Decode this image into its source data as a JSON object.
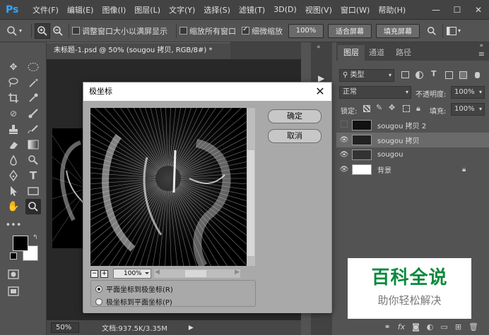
{
  "menubar": {
    "logo": "Ps",
    "items": [
      "文件(F)",
      "编辑(E)",
      "图像(I)",
      "图层(L)",
      "文字(Y)",
      "选择(S)",
      "滤镜(T)",
      "3D(D)",
      "视图(V)",
      "窗口(W)",
      "帮助(H)"
    ],
    "minimize": "—",
    "maximize": "☐",
    "close": "✕"
  },
  "options": {
    "resize_windows": "调整窗口大小以满屏显示",
    "zoom_all": "缩放所有窗口",
    "scrubby_zoom": "细微缩放",
    "zoom_value": "100%",
    "fit_screen": "适合屏幕",
    "fill_screen": "填充屏幕"
  },
  "document": {
    "tab_title": "未标题-1.psd @ 50% (sougou 拷贝, RGB/8#) *",
    "tab_close": "×",
    "status_zoom": "50%",
    "doc_size": "文档:937.5K/3.35M"
  },
  "dialog": {
    "title": "极坐标",
    "ok": "确定",
    "cancel": "取消",
    "zoom": "100%",
    "zoom_out": "−",
    "zoom_in": "+",
    "option_rect_to_polar": "平面坐标到极坐标(R)",
    "option_polar_to_rect": "极坐标到平面坐标(P)"
  },
  "layers_panel": {
    "tabs": [
      "图层",
      "通道",
      "路径"
    ],
    "filter_kind": "类型",
    "blend_mode": "正常",
    "opacity_label": "不透明度:",
    "opacity_value": "100%",
    "lock_label": "锁定:",
    "fill_label": "填充:",
    "fill_value": "100%",
    "layers": [
      {
        "name": "sougou 拷贝 2",
        "visible": false,
        "selected": false
      },
      {
        "name": "sougou 拷贝",
        "visible": true,
        "selected": true
      },
      {
        "name": "sougou",
        "visible": true,
        "selected": false
      },
      {
        "name": "背景",
        "visible": true,
        "selected": false
      }
    ]
  },
  "watermark": {
    "title": "百科全说",
    "subtitle": "助你轻松解决"
  },
  "colors": {
    "accent": "#31a8ff",
    "watermark_green": "#0a8a3c"
  }
}
